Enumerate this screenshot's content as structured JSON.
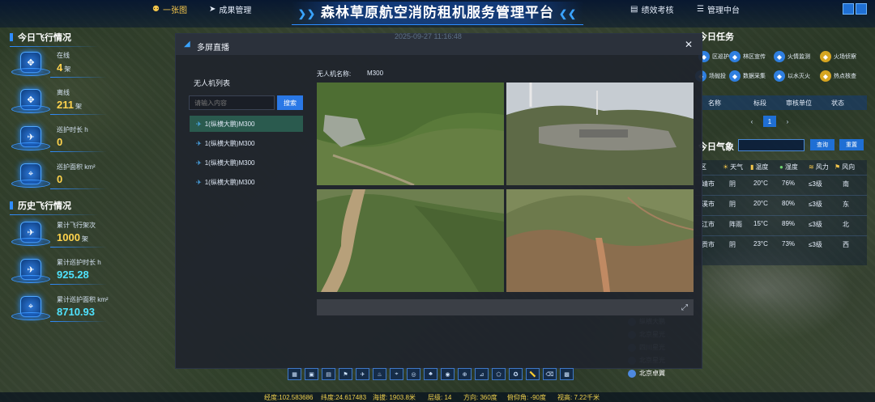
{
  "header": {
    "title": "森林草原航空消防租机服务管理平台",
    "left_nav": [
      {
        "label": "一张图",
        "icon": "user-icon",
        "active": true
      },
      {
        "label": "成果管理",
        "icon": "send-icon",
        "active": false
      }
    ],
    "right_nav": [
      {
        "label": "绩效考核",
        "icon": "document-icon"
      },
      {
        "label": "管理中台",
        "icon": "database-icon"
      }
    ]
  },
  "left_panel": {
    "today_title": "今日飞行情况",
    "today_stats": [
      {
        "label": "在线",
        "value": "4",
        "unit": "架",
        "icon": "drone-icon"
      },
      {
        "label": "离线",
        "value": "211",
        "unit": "架",
        "icon": "drone-icon"
      },
      {
        "label": "巡护时长 h",
        "value": "0",
        "unit": "",
        "icon": "plane-icon"
      },
      {
        "label": "巡护面积 km²",
        "value": "0",
        "unit": "",
        "icon": "location-icon"
      }
    ],
    "history_title": "历史飞行情况",
    "history_stats": [
      {
        "label": "累计飞行架次",
        "value": "1000",
        "unit": "架",
        "icon": "plane-icon"
      },
      {
        "label": "累计巡护时长 h",
        "value": "925.28",
        "unit": "",
        "icon": "plane-icon"
      },
      {
        "label": "累计巡护面积 km²",
        "value": "8710.93",
        "unit": "",
        "icon": "location-icon"
      }
    ]
  },
  "right_panel": {
    "tasks_title": "今日任务",
    "tasks": [
      {
        "label": "区巡护",
        "color": "#2f7fe0"
      },
      {
        "label": "林区宣传",
        "color": "#2f7fe0"
      },
      {
        "label": "火情监测",
        "color": "#2f7fe0"
      },
      {
        "label": "火场侦察",
        "color": "#d6a520"
      },
      {
        "label": "场抛投",
        "color": "#2f7fe0"
      },
      {
        "label": "数据采集",
        "color": "#2f7fe0"
      },
      {
        "label": "以水灭火",
        "color": "#2f7fe0"
      },
      {
        "label": "热点核查",
        "color": "#d6a520"
      }
    ],
    "task_table_headers": [
      "名称",
      "标段",
      "审核单位",
      "状态"
    ],
    "pager": {
      "prev": "‹",
      "current": "1",
      "next": "›"
    },
    "weather_title": "今日气象",
    "weather_query": "查询",
    "weather_reset": "重置",
    "weather_headers": [
      "区",
      "天气",
      "温度",
      "湿度",
      "风力",
      "风向"
    ],
    "weather_rows": [
      [
        "靖市",
        "阴",
        "20°C",
        "76%",
        "≤3级",
        "南"
      ],
      [
        "溪市",
        "阴",
        "20°C",
        "80%",
        "≤3级",
        "东"
      ],
      [
        "江市",
        "阵雨",
        "15°C",
        "89%",
        "≤3级",
        "北"
      ],
      [
        "贡市",
        "阴",
        "23°C",
        "73%",
        "≤3级",
        "西"
      ]
    ]
  },
  "modal": {
    "title": "多屏直播",
    "datetime": "2025-09-27 11:16:48",
    "list_title": "无人机列表",
    "search_placeholder": "请输入内容",
    "search_button": "搜索",
    "devices": [
      "1(纵横大鹏)M300",
      "1(纵横大鹏)M300",
      "1(纵横大鹏)M300",
      "1(纵横大鹏)M300"
    ],
    "uav_name_label": "无人机名称:",
    "uav_name": "M300"
  },
  "map_legend": {
    "items": [
      "纵横大鹏",
      "北京星光",
      "四川星光",
      "北京星光"
    ],
    "active": "北京卓翼"
  },
  "status_bar": {
    "lon": "经度:102.583686",
    "lat": "纬度:24.617483",
    "alt": "海拔: 1903.8米",
    "level": "层级: 14",
    "heading": "方向: 360度",
    "pitch": "俯仰角: -90度",
    "height": "视高: 7.22千米"
  },
  "tools": [
    "layers-icon",
    "map-icon",
    "grid-icon",
    "flag-icon",
    "plane-icon",
    "fire-icon",
    "pin-icon",
    "target-icon",
    "tree-icon",
    "locate-icon",
    "globe-icon",
    "measure-icon",
    "polygon-icon",
    "compass-icon",
    "ruler-icon",
    "eraser-icon",
    "cube-icon"
  ]
}
